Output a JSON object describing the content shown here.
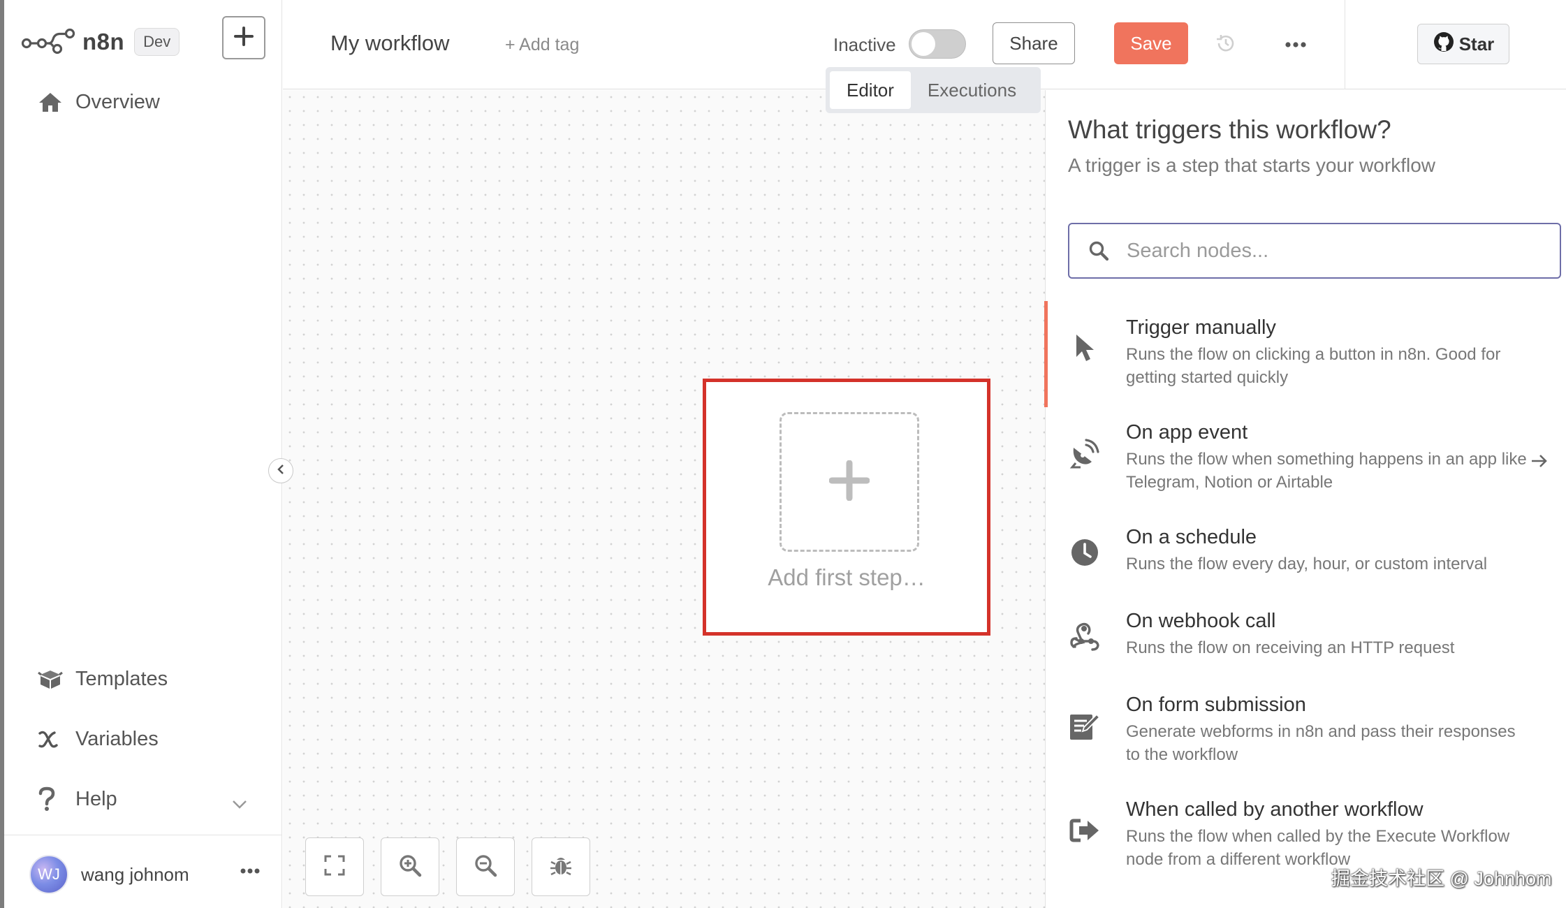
{
  "sidebar": {
    "logo_text": "n8n",
    "env_badge": "Dev",
    "nav": {
      "overview": "Overview",
      "templates": "Templates",
      "variables": "Variables",
      "help": "Help"
    },
    "user": {
      "initials": "WJ",
      "name": "wang johnom"
    }
  },
  "header": {
    "workflow_name": "My workflow",
    "add_tag": "+ Add tag",
    "status_label": "Inactive",
    "active": false,
    "share_label": "Share",
    "save_label": "Save",
    "star_label": "Star",
    "tabs": [
      {
        "label": "Editor",
        "active": true
      },
      {
        "label": "Executions",
        "active": false
      }
    ]
  },
  "canvas": {
    "add_first_step": "Add first step…",
    "tools": [
      "fit-view-icon",
      "zoom-in-icon",
      "zoom-out-icon",
      "debug-icon"
    ]
  },
  "panel": {
    "title": "What triggers this workflow?",
    "subtitle": "A trigger is a step that starts your workflow",
    "search_placeholder": "Search nodes...",
    "items": [
      {
        "name": "Trigger manually",
        "description": "Runs the flow on clicking a button in n8n. Good for getting started quickly",
        "icon": "cursor-icon"
      },
      {
        "name": "On app event",
        "description": "Runs the flow when something happens in an app like Telegram, Notion or Airtable",
        "icon": "satellite-icon"
      },
      {
        "name": "On a schedule",
        "description": "Runs the flow every day, hour, or custom interval",
        "icon": "clock-icon"
      },
      {
        "name": "On webhook call",
        "description": "Runs the flow on receiving an HTTP request",
        "icon": "webhook-icon"
      },
      {
        "name": "On form submission",
        "description": "Generate webforms in n8n and pass their responses to the workflow",
        "icon": "form-icon"
      },
      {
        "name": "When called by another workflow",
        "description": "Runs the flow when called by the Execute Workflow node from a different workflow",
        "icon": "sign-in-icon"
      }
    ]
  },
  "watermark": "掘金技术社区 @ Johnhom",
  "colors": {
    "accent": "#f0745d",
    "highlight_frame": "#d4322a",
    "search_border": "#6e6ea8"
  }
}
